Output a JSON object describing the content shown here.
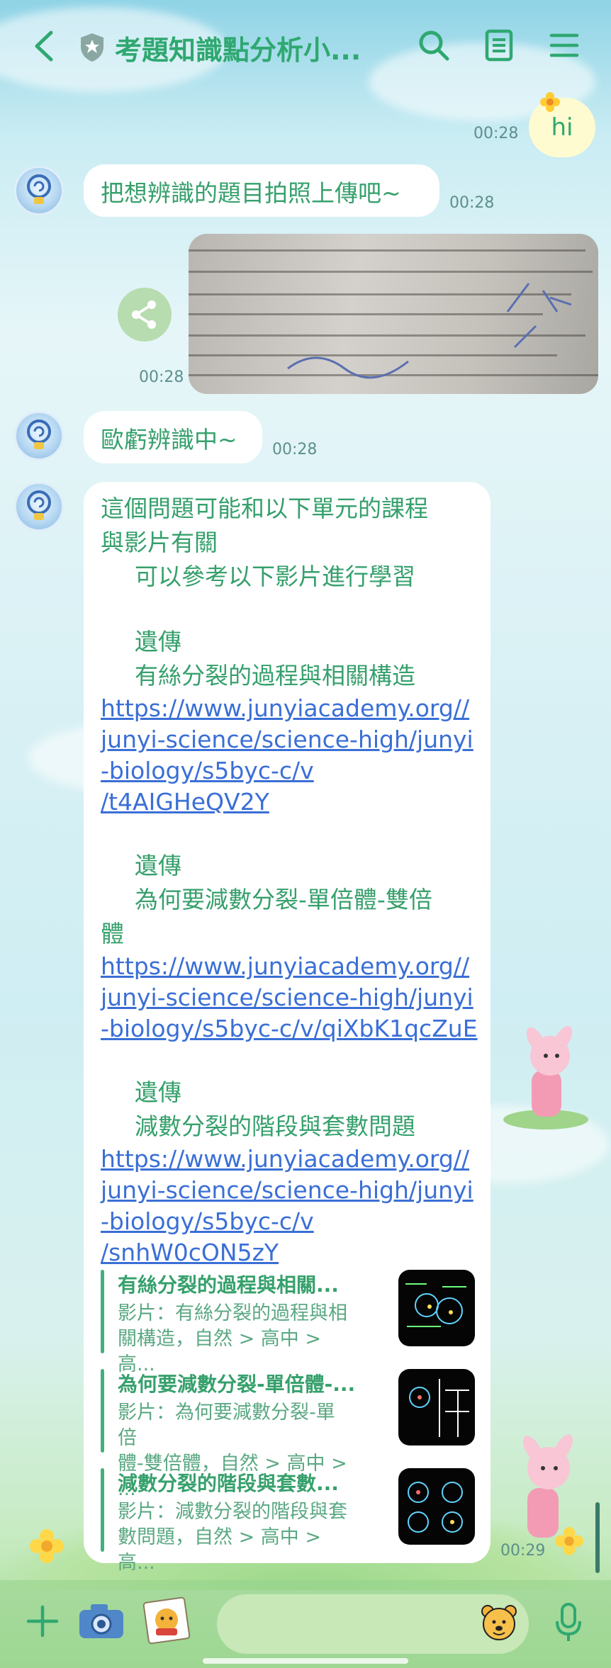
{
  "header": {
    "title": "考題知識點分析小...",
    "back_icon": "chevron-left-icon",
    "shield_icon": "shield-icon",
    "search_icon": "search-icon",
    "notes_icon": "notes-icon",
    "menu_icon": "menu-icon"
  },
  "colors": {
    "accent": "#2fa870",
    "link": "#3a6fd6",
    "bubble": "#ffffff",
    "own_bubble": "#fffbd0"
  },
  "messages": {
    "hi": {
      "text": "hi",
      "time": "00:28"
    },
    "prompt": {
      "text": "把想辨識的題目拍照上傳吧~",
      "time": "00:28"
    },
    "photo": {
      "time": "00:28",
      "share_icon": "share-icon"
    },
    "recognizing": {
      "text": "歐虧辨識中~",
      "time": "00:28"
    },
    "result": {
      "intro1": "這個問題可能和以下單元的課程",
      "intro2": "與影片有關",
      "intro3": "可以參考以下影片進行學習",
      "unit1": "遺傳",
      "topic1": "有絲分裂的過程與相關構造",
      "link1": [
        "https://www.junyiacademy.org//",
        "junyi-science/science-high/junyi",
        "-biology/s5byc-c/v",
        "/t4AIGHeQV2Y"
      ],
      "unit2": "遺傳",
      "topic2a": "為何要減數分裂-單倍體-雙倍",
      "topic2b": "體",
      "link2": [
        "https://www.junyiacademy.org//",
        "junyi-science/science-high/junyi",
        "-biology/s5byc-c/v/qiXbK1qcZuE"
      ],
      "unit3": "遺傳",
      "topic3": "減數分裂的階段與套數問題",
      "link3": [
        "https://www.junyiacademy.org//",
        "junyi-science/science-high/junyi",
        "-biology/s5byc-c/v",
        "/snhW0cON5zY"
      ],
      "time": "00:29"
    },
    "cards": [
      {
        "title": "有絲分裂的過程與相關...",
        "desc1": "影片：有絲分裂的過程與相",
        "desc2": "關構造，自然 > 高中 > 高..."
      },
      {
        "title": "為何要減數分裂-單倍體-...",
        "desc1": "影片：為何要減數分裂-單倍",
        "desc2": "體-雙倍體，自然 > 高中 > ..."
      },
      {
        "title": "減數分裂的階段與套數...",
        "desc1": "影片：減數分裂的階段與套",
        "desc2": "數問題，自然 > 高中 > 高..."
      }
    ]
  },
  "bottom_bar": {
    "plus_icon": "plus-icon",
    "camera_icon": "camera-icon",
    "gallery_icon": "gallery-icon",
    "sticker_icon": "sticker-icon",
    "mic_icon": "mic-icon"
  }
}
